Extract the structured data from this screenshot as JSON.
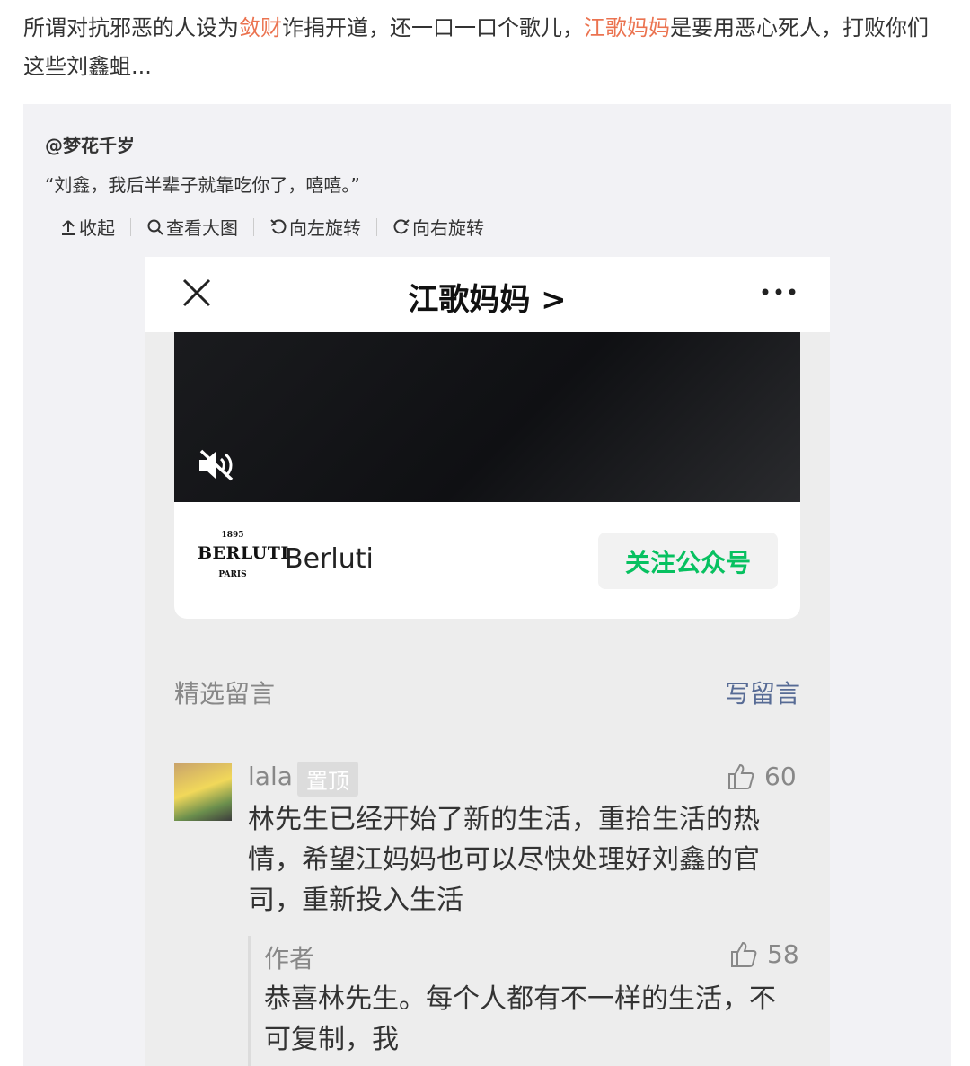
{
  "post": {
    "part1": "所谓对抗邪恶的人设为",
    "link1": "敛财",
    "part2": "诈捐开道，还一口一口个歌儿，",
    "link2": "江歌妈妈",
    "part3": "是要用恶心死人，打败你们这些刘鑫蛆..."
  },
  "repost": {
    "user": "@梦花千岁",
    "quote": "“刘鑫，我后半辈子就靠吃你了，嘻嘻。”"
  },
  "toolbar": {
    "collapse": "收起",
    "view_large": "查看大图",
    "rotate_left": "向左旋转",
    "rotate_right": "向右旋转"
  },
  "screenshot": {
    "title": "江歌妈妈 >",
    "logo": {
      "year": "1895",
      "brand": "BERLUTI",
      "city": "PARIS"
    },
    "account_name": "Berluti",
    "follow_label": "关注公众号",
    "selected_comments_label": "精选留言",
    "write_comment_label": "写留言",
    "comment": {
      "name": "lala",
      "pinned": "置顶",
      "likes": "60",
      "text": "林先生已经开始了新的生活，重拾生活的热情，希望江妈妈也可以尽快处理好刘鑫的官司，重新投入生活"
    },
    "reply": {
      "author": "作者",
      "likes": "58",
      "text": "恭喜林先生。每个人都有不一样的生活，不可复制，我"
    }
  },
  "colors": {
    "link": "#eb7350",
    "wechat_green": "#07c160",
    "wechat_link": "#576b95"
  }
}
